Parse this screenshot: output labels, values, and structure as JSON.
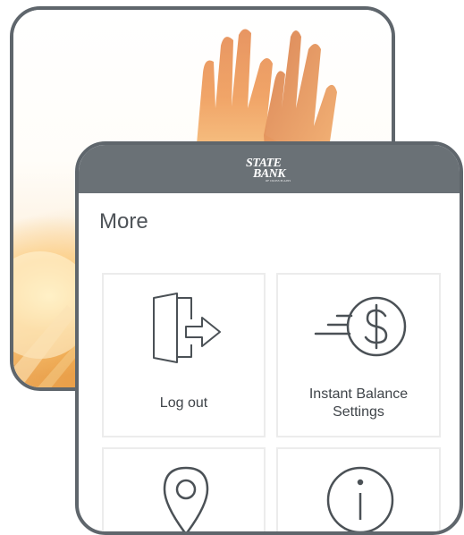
{
  "app": {
    "logo": {
      "line1": "STATE",
      "line2": "BANK",
      "line3": "OF CROSS PLAINS"
    }
  },
  "page": {
    "title": "More"
  },
  "tiles": [
    {
      "label": "Log out",
      "icon": "logout-door-icon"
    },
    {
      "label": "Instant Balance Settings",
      "icon": "instant-balance-dollar-icon"
    },
    {
      "label": "",
      "icon": "location-pin-icon"
    },
    {
      "label": "",
      "icon": "info-icon"
    }
  ],
  "colors": {
    "frame": "#5f666c",
    "header": "#6a7176",
    "icon_stroke": "#4b5156",
    "tile_border": "#ececec",
    "photo_glow": "#e9a356"
  }
}
